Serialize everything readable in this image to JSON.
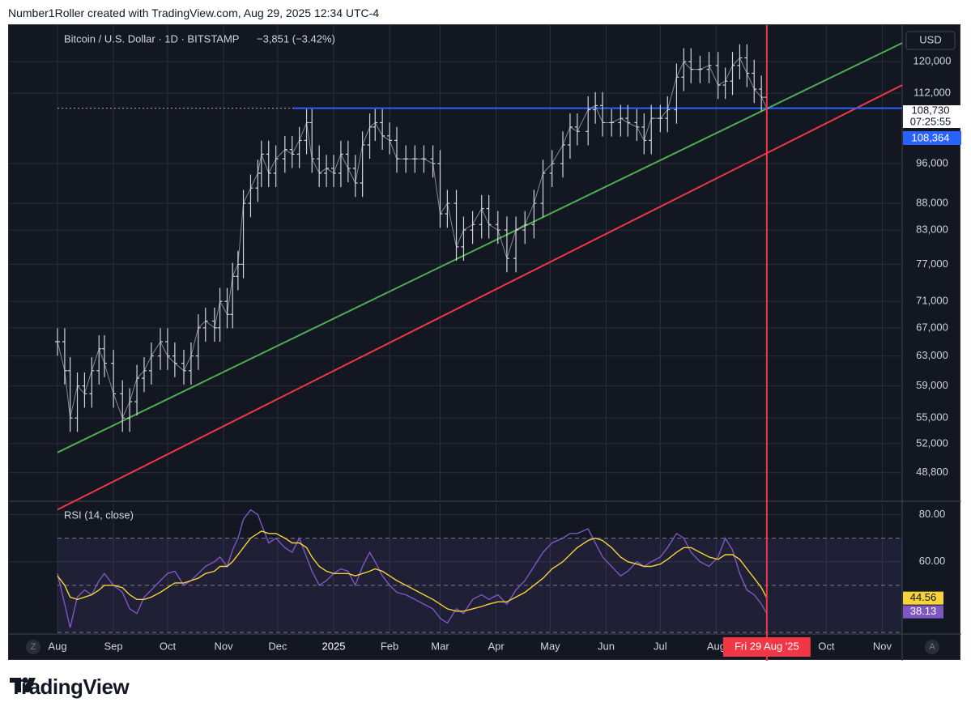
{
  "header": {
    "text": "Number1Roller created with TradingView.com, Aug 29, 2025 12:34 UTC-4"
  },
  "footer": {
    "brand": "TradingView"
  },
  "colors": {
    "bg": "#131722",
    "grid": "#2a2e39",
    "candle": "#d1d4dc",
    "green_line": "#4caf50",
    "red_line": "#f23645",
    "blue_line": "#2962ff",
    "rsi": "#7e57c2",
    "rsi_ma": "#f7d33a"
  },
  "chart_data": [
    {
      "type": "line",
      "title": "Bitcoin / U.S. Dollar · 1D · BITSTAMP",
      "change": "−3,851 (−3.42%)",
      "currency": "USD",
      "scale": "log",
      "ylim": [
        46000,
        130000
      ],
      "y_ticks": [
        "120,000",
        "112,000",
        "96,000",
        "88,000",
        "83,000",
        "77,000",
        "71,000",
        "67,000",
        "63,000",
        "59,000",
        "55,000",
        "52,000",
        "48,800"
      ],
      "x_ticks": [
        "Aug",
        "Sep",
        "Oct",
        "Nov",
        "Dec",
        "2025",
        "Feb",
        "Mar",
        "Apr",
        "May",
        "Jun",
        "Jul",
        "Aug",
        "Oct",
        "Nov"
      ],
      "price_labels": {
        "last": "108,730",
        "countdown": "07:25:55",
        "level": "108,364"
      },
      "crosshair_label": "Fri 29 Aug '25",
      "axis_buttons": {
        "left": "Z",
        "right": "A"
      },
      "series": [
        {
          "name": "BTCUSD",
          "x": [
            "2024-08-01",
            "2024-08-05",
            "2024-08-08",
            "2024-08-12",
            "2024-08-16",
            "2024-08-20",
            "2024-08-24",
            "2024-08-27",
            "2024-09-01",
            "2024-09-06",
            "2024-09-10",
            "2024-09-14",
            "2024-09-18",
            "2024-09-22",
            "2024-09-27",
            "2024-10-01",
            "2024-10-05",
            "2024-10-10",
            "2024-10-14",
            "2024-10-18",
            "2024-10-22",
            "2024-10-27",
            "2024-10-30",
            "2024-11-03",
            "2024-11-06",
            "2024-11-09",
            "2024-11-12",
            "2024-11-16",
            "2024-11-20",
            "2024-11-22",
            "2024-11-26",
            "2024-11-30",
            "2024-12-05",
            "2024-12-09",
            "2024-12-13",
            "2024-12-17",
            "2024-12-20",
            "2024-12-24",
            "2024-12-28",
            "2025-01-01",
            "2025-01-05",
            "2025-01-09",
            "2025-01-13",
            "2025-01-17",
            "2025-01-21",
            "2025-01-24",
            "2025-01-28",
            "2025-02-01",
            "2025-02-05",
            "2025-02-10",
            "2025-02-15",
            "2025-02-20",
            "2025-02-25",
            "2025-03-01",
            "2025-03-05",
            "2025-03-10",
            "2025-03-14",
            "2025-03-19",
            "2025-03-24",
            "2025-03-28",
            "2025-04-02",
            "2025-04-07",
            "2025-04-12",
            "2025-04-17",
            "2025-04-22",
            "2025-04-27",
            "2025-05-02",
            "2025-05-08",
            "2025-05-12",
            "2025-05-16",
            "2025-05-22",
            "2025-05-26",
            "2025-05-30",
            "2025-06-04",
            "2025-06-09",
            "2025-06-13",
            "2025-06-18",
            "2025-06-22",
            "2025-06-26",
            "2025-07-01",
            "2025-07-05",
            "2025-07-10",
            "2025-07-14",
            "2025-07-18",
            "2025-07-23",
            "2025-07-28",
            "2025-08-02",
            "2025-08-06",
            "2025-08-10",
            "2025-08-14",
            "2025-08-18",
            "2025-08-22",
            "2025-08-26",
            "2025-08-29"
          ],
          "values": [
            65000,
            61000,
            55000,
            59000,
            58000,
            61000,
            64000,
            62000,
            58000,
            55000,
            57000,
            60000,
            61000,
            63000,
            65000,
            63000,
            62000,
            61000,
            63000,
            67000,
            68000,
            67000,
            71000,
            69000,
            75000,
            77000,
            88000,
            91000,
            94000,
            98000,
            94000,
            97000,
            99000,
            98000,
            101000,
            105000,
            97000,
            94000,
            95000,
            94000,
            98000,
            95000,
            92000,
            100000,
            104000,
            105000,
            102000,
            101000,
            97000,
            97000,
            97000,
            97000,
            96000,
            86000,
            88000,
            80000,
            83000,
            84000,
            87000,
            84000,
            83000,
            78000,
            83000,
            84000,
            88000,
            94000,
            96000,
            100000,
            104000,
            103000,
            108000,
            109000,
            105000,
            105000,
            106000,
            105000,
            104000,
            101000,
            106000,
            106000,
            108000,
            116000,
            120000,
            118000,
            118000,
            119000,
            114000,
            115000,
            119000,
            121000,
            117000,
            113000,
            111000,
            108364
          ]
        }
      ],
      "trendlines": [
        {
          "name": "green",
          "x": [
            "2024-08-01",
            "2025-11-12"
          ],
          "y": [
            51000,
            125000
          ]
        },
        {
          "name": "red",
          "x": [
            "2024-08-01",
            "2025-11-12"
          ],
          "y": [
            45000,
            114000
          ]
        }
      ],
      "horizontal_line": {
        "y": 108364,
        "from": "2024-12-10"
      },
      "vertical_line": {
        "x": "2025-08-29"
      }
    },
    {
      "type": "line",
      "title": "RSI (14, close)",
      "ylim": [
        30,
        85
      ],
      "y_ticks": [
        "80.00",
        "60.00"
      ],
      "levels": [
        70,
        50,
        30
      ],
      "value_labels": {
        "rsi_ma": "44.56",
        "rsi": "38.13"
      },
      "series": [
        {
          "name": "RSI",
          "values": [
            55,
            42,
            32,
            45,
            48,
            46,
            52,
            55,
            50,
            47,
            40,
            38,
            45,
            48,
            52,
            55,
            56,
            50,
            52,
            55,
            58,
            60,
            62,
            58,
            65,
            70,
            78,
            82,
            80,
            76,
            68,
            70,
            66,
            64,
            70,
            62,
            56,
            50,
            52,
            55,
            57,
            56,
            50,
            58,
            64,
            60,
            54,
            50,
            47,
            46,
            44,
            42,
            40,
            36,
            34,
            40,
            38,
            44,
            46,
            44,
            46,
            42,
            48,
            52,
            58,
            64,
            68,
            70,
            72,
            72,
            74,
            68,
            62,
            58,
            54,
            56,
            60,
            58,
            60,
            62,
            66,
            72,
            70,
            64,
            60,
            58,
            62,
            70,
            65,
            55,
            48,
            46,
            42,
            38
          ]
        },
        {
          "name": "RSI-based MA",
          "values": [
            54,
            50,
            45,
            44,
            45,
            46,
            48,
            50,
            50,
            49,
            46,
            44,
            44,
            45,
            47,
            49,
            51,
            51,
            52,
            53,
            55,
            56,
            58,
            58,
            60,
            63,
            66,
            70,
            72,
            73,
            72,
            72,
            70,
            68,
            68,
            66,
            62,
            58,
            56,
            55,
            55,
            55,
            54,
            55,
            56,
            57,
            56,
            54,
            52,
            50,
            48,
            46,
            44,
            42,
            40,
            39,
            39,
            40,
            41,
            42,
            43,
            43,
            45,
            47,
            50,
            53,
            57,
            60,
            63,
            66,
            69,
            70,
            69,
            66,
            62,
            60,
            59,
            58,
            58,
            59,
            61,
            64,
            66,
            66,
            64,
            62,
            61,
            63,
            63,
            61,
            57,
            53,
            49,
            44.56
          ]
        }
      ]
    }
  ]
}
